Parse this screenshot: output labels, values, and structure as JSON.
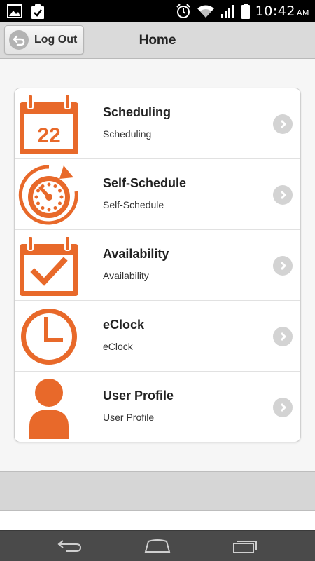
{
  "status_bar": {
    "time": "10:42",
    "ampm": "AM",
    "left_icons": [
      "image-icon",
      "clipboard-check-icon"
    ],
    "right_icons": [
      "alarm-icon",
      "wifi-icon",
      "signal-icon",
      "battery-icon"
    ]
  },
  "header": {
    "title": "Home",
    "logout_label": "Log Out",
    "logout_icon": "undo-arrow-icon"
  },
  "menu": [
    {
      "title": "Scheduling",
      "subtitle": "Scheduling",
      "icon": "calendar-icon",
      "calendar_day": "22"
    },
    {
      "title": "Self-Schedule",
      "subtitle": "Self-Schedule",
      "icon": "stopwatch-refresh-icon"
    },
    {
      "title": "Availability",
      "subtitle": "Availability",
      "icon": "calendar-check-icon"
    },
    {
      "title": "eClock",
      "subtitle": "eClock",
      "icon": "clock-icon"
    },
    {
      "title": "User Profile",
      "subtitle": "User Profile",
      "icon": "user-icon"
    }
  ],
  "nav_bar": {
    "buttons": [
      "back-icon",
      "home-icon",
      "recents-icon"
    ]
  },
  "colors": {
    "accent": "#e8692a",
    "header_bg": "#dadada",
    "chevron_bg": "#d3d3d3",
    "nav_bg": "#4a4a4a"
  }
}
